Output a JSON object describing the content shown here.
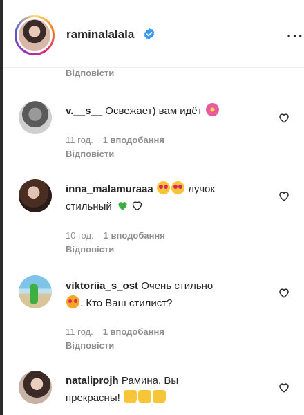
{
  "header": {
    "username": "raminalalala",
    "verified_icon": "verified-badge-icon",
    "more_label": "···"
  },
  "top_reply_label": "Відповісти",
  "comments": [
    {
      "username": "v.__s__",
      "text": "Освежает) вам идёт",
      "emoji": [
        "flower-emoji"
      ],
      "time": "11 год.",
      "likes": "1 вподобання",
      "reply": "Відповісти"
    },
    {
      "username": "inna_malamuraaa",
      "text_before": "",
      "text_after": "лучок",
      "line2": "стильный",
      "emoji": [
        "heart-eyes-emoji",
        "heart-eyes-emoji",
        "green-heart-emoji",
        "white-heart-emoji"
      ],
      "time": "10 год.",
      "likes": "1 вподобання",
      "reply": "Відповісти"
    },
    {
      "username": "viktoriia_s_ost",
      "text": "Очень стильно",
      "line2": ". Кто Ваш стилист?",
      "emoji": [
        "heart-eyes-cat-emoji"
      ],
      "time": "11 год.",
      "likes": "1 вподобання",
      "reply": "Відповісти"
    },
    {
      "username": "nataliprojh",
      "text": "Рамина, Вы",
      "line2": "прекрасны!",
      "emoji": [
        "thumbs-up-emoji",
        "thumbs-up-emoji",
        "thumbs-up-emoji"
      ]
    }
  ],
  "colors": {
    "text": "#262626",
    "secondary": "#8e8e8e",
    "verified": "#3897f0",
    "green_heart": "#3cb043"
  }
}
